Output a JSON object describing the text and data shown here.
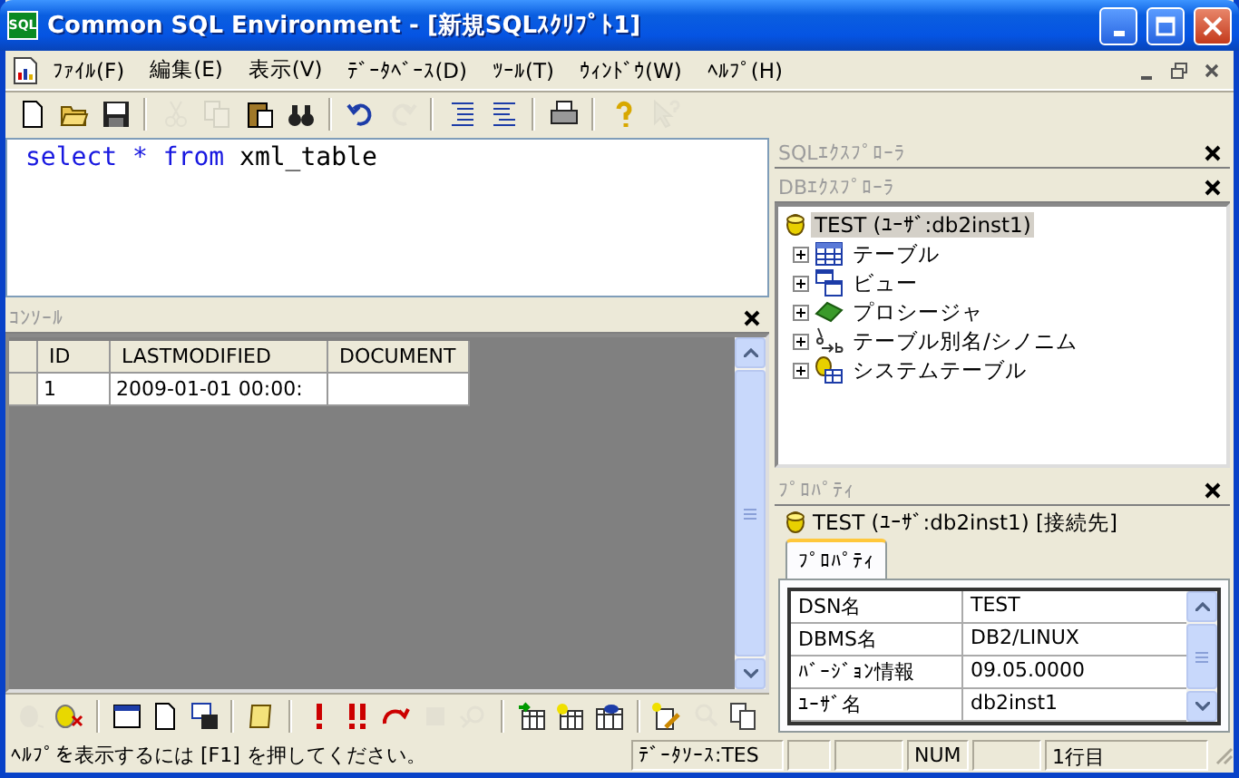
{
  "window": {
    "title": "Common SQL Environment - [新規SQLｽｸﾘﾌﾟﾄ1]",
    "app_icon": "SQL"
  },
  "menu": [
    {
      "label": "ﾌｧｲﾙ(F)"
    },
    {
      "label": "編集(E)"
    },
    {
      "label": "表示(V)"
    },
    {
      "label": "ﾃﾞｰﾀﾍﾞｰｽ(D)"
    },
    {
      "label": "ﾂｰﾙ(T)"
    },
    {
      "label": "ｳｨﾝﾄﾞｳ(W)"
    },
    {
      "label": "ﾍﾙﾌﾟ(H)"
    }
  ],
  "toolbar": [
    {
      "kind": "new",
      "disabled": false
    },
    {
      "kind": "open",
      "disabled": false
    },
    {
      "kind": "save",
      "disabled": false
    },
    {
      "kind": "separator"
    },
    {
      "kind": "cut",
      "disabled": true
    },
    {
      "kind": "copy",
      "disabled": true
    },
    {
      "kind": "paste",
      "disabled": false
    },
    {
      "kind": "find",
      "disabled": false
    },
    {
      "kind": "separator"
    },
    {
      "kind": "undo",
      "disabled": false
    },
    {
      "kind": "redo",
      "disabled": true
    },
    {
      "kind": "separator"
    },
    {
      "kind": "indent",
      "disabled": false
    },
    {
      "kind": "outdent",
      "disabled": false
    },
    {
      "kind": "separator"
    },
    {
      "kind": "print",
      "disabled": false
    },
    {
      "kind": "separator"
    },
    {
      "kind": "help",
      "disabled": false
    },
    {
      "kind": "whatsthis",
      "disabled": true
    }
  ],
  "editor": {
    "tokens": [
      {
        "text": "select",
        "kind": "keyword"
      },
      {
        "text": "*",
        "kind": "keyword"
      },
      {
        "text": "from",
        "kind": "keyword"
      },
      {
        "text": "xml_table",
        "kind": "name"
      }
    ]
  },
  "console": {
    "title": "ｺﾝｿｰﾙ",
    "columns": [
      "ID",
      "LASTMODIFIED",
      "DOCUMENT"
    ],
    "rows": [
      {
        "cells": [
          "1",
          "2009-01-01 00:00:"
        ]
      }
    ]
  },
  "bottom_toolbar": [
    {
      "kind": "dbconnect",
      "disabled": true
    },
    {
      "kind": "dbdisconnect",
      "disabled": false
    },
    {
      "kind": "separator"
    },
    {
      "kind": "window",
      "disabled": false
    },
    {
      "kind": "new",
      "disabled": false
    },
    {
      "kind": "savewin",
      "disabled": false
    },
    {
      "kind": "separator"
    },
    {
      "kind": "scroll",
      "disabled": false
    },
    {
      "kind": "separator"
    },
    {
      "kind": "exclaim",
      "disabled": false
    },
    {
      "kind": "exclaim2",
      "disabled": false
    },
    {
      "kind": "stepover",
      "disabled": false
    },
    {
      "kind": "stop",
      "disabled": true
    },
    {
      "kind": "plan",
      "disabled": true
    },
    {
      "kind": "separator"
    },
    {
      "kind": "tablein",
      "disabled": false
    },
    {
      "kind": "tablestar",
      "disabled": false
    },
    {
      "kind": "tableeye",
      "disabled": false
    },
    {
      "kind": "separator"
    },
    {
      "kind": "editstar",
      "disabled": false
    },
    {
      "kind": "search",
      "disabled": true
    },
    {
      "kind": "copy",
      "disabled": false
    }
  ],
  "sql_explorer": {
    "title": "SQLｴｸｽﾌﾟﾛｰﾗ"
  },
  "db_explorer": {
    "title": "DBｴｸｽﾌﾟﾛｰﾗ",
    "root": {
      "label": "TEST (ﾕｰｻﾞ:db2inst1)",
      "selected": true,
      "children": [
        {
          "label": "テーブル",
          "kind": "table",
          "expanded": false
        },
        {
          "label": "ビュー",
          "kind": "view",
          "expanded": false
        },
        {
          "label": "プロシージャ",
          "kind": "procedure",
          "expanded": false
        },
        {
          "label": "テーブル別名/シノニム",
          "kind": "alias",
          "expanded": false
        },
        {
          "label": "システムテーブル",
          "kind": "systable",
          "expanded": false
        }
      ]
    }
  },
  "properties": {
    "title": "ﾌﾟﾛﾊﾟﾃｨ",
    "connection": "TEST (ﾕｰｻﾞ:db2inst1) [接続先]",
    "tabs": [
      {
        "label": "ﾌﾟﾛﾊﾟﾃｨ",
        "selected": true
      }
    ],
    "rows": [
      {
        "name": "DSN名",
        "value": "TEST"
      },
      {
        "name": "DBMS名",
        "value": "DB2/LINUX"
      },
      {
        "name": "ﾊﾞｰｼﾞｮﾝ情報",
        "value": "09.05.0000"
      },
      {
        "name": "ﾕｰｻﾞ名",
        "value": "db2inst1"
      }
    ]
  },
  "status_bar": {
    "message": "ﾍﾙﾌﾟを表示するには [F1] を押してください。",
    "panels": [
      "ﾃﾞｰﾀｿｰｽ:TES",
      "NUM",
      "1行目"
    ]
  }
}
